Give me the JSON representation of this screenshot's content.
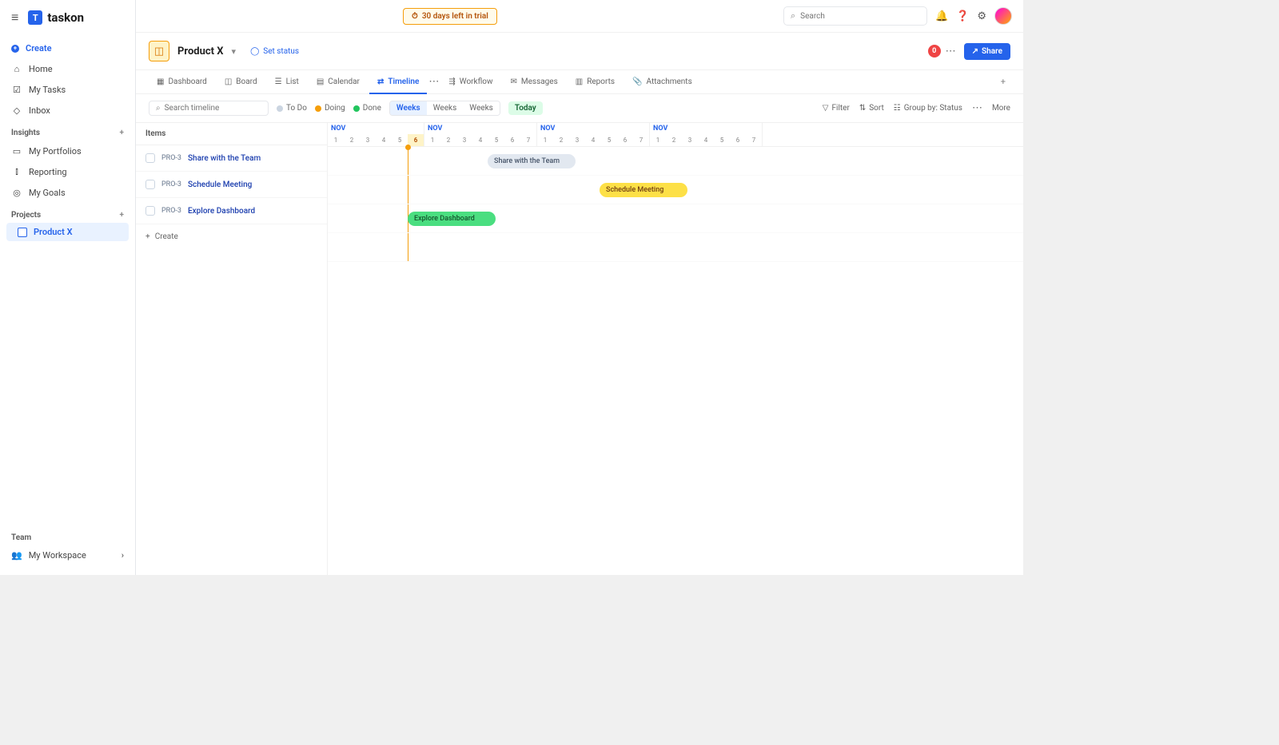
{
  "brand": {
    "logoLetter": "T",
    "name": "taskon"
  },
  "topbar": {
    "trialText": "30 days left in trial",
    "searchPlaceholder": "Search"
  },
  "sidebar": {
    "create": "Create",
    "primary": [
      {
        "label": "Home",
        "icon": "home"
      },
      {
        "label": "My Tasks",
        "icon": "check"
      },
      {
        "label": "Inbox",
        "icon": "bell"
      }
    ],
    "insightsLabel": "Insights",
    "insights": [
      {
        "label": "My Portfolios",
        "icon": "folder"
      },
      {
        "label": "Reporting",
        "icon": "chart"
      },
      {
        "label": "My Goals",
        "icon": "target"
      }
    ],
    "projectsLabel": "Projects",
    "projects": [
      {
        "label": "Product X"
      }
    ],
    "teamLabel": "Team",
    "team": [
      {
        "label": "My Workspace"
      }
    ]
  },
  "project": {
    "name": "Product X",
    "setStatus": "Set status",
    "collabCount": "0",
    "shareLabel": "Share"
  },
  "views": {
    "tabs": [
      {
        "label": "Dashboard",
        "icon": "grid"
      },
      {
        "label": "Board",
        "icon": "board"
      },
      {
        "label": "List",
        "icon": "list"
      },
      {
        "label": "Calendar",
        "icon": "calendar"
      },
      {
        "label": "Timeline",
        "icon": "timeline",
        "active": true
      },
      {
        "label": "Workflow",
        "icon": "flow"
      },
      {
        "label": "Messages",
        "icon": "msg"
      },
      {
        "label": "Reports",
        "icon": "report"
      },
      {
        "label": "Attachments",
        "icon": "attach"
      }
    ]
  },
  "toolbar": {
    "searchPlaceholder": "Search timeline",
    "statuses": [
      {
        "label": "To Do",
        "color": "#cbd5e1"
      },
      {
        "label": "Doing",
        "color": "#f59e0b"
      },
      {
        "label": "Done",
        "color": "#22c55e"
      }
    ],
    "zoom": [
      "Weeks",
      "Weeks",
      "Weeks"
    ],
    "zoomActive": "Weeks",
    "today": "Today",
    "filter": "Filter",
    "sort": "Sort",
    "groupBy": "Group by: Status",
    "more": "More"
  },
  "itemsPanel": {
    "heading": "Items",
    "rows": [
      {
        "id": "PRO-3",
        "name": "Share with the Team"
      },
      {
        "id": "PRO-3",
        "name": "Schedule Meeting"
      },
      {
        "id": "PRO-3",
        "name": "Explore Dashboard"
      }
    ],
    "createLabel": "Create"
  },
  "timeline": {
    "blocks": [
      {
        "month": "NOV",
        "days": [
          1,
          2,
          3,
          4,
          5,
          6
        ]
      },
      {
        "month": "NOV",
        "days": [
          1,
          2,
          3,
          4,
          5,
          6,
          7
        ]
      },
      {
        "month": "NOV",
        "days": [
          1,
          2,
          3,
          4,
          5,
          6,
          7
        ]
      },
      {
        "month": "NOV",
        "days": [
          1,
          2,
          3,
          4,
          5,
          6,
          7
        ]
      }
    ],
    "bars": [
      {
        "lane": 0,
        "label": "Share with the Team",
        "cls": "grey"
      },
      {
        "lane": 1,
        "label": "Schedule Meeting",
        "cls": "yellow"
      },
      {
        "lane": 2,
        "label": "Explore Dashboard",
        "cls": "green"
      }
    ]
  }
}
